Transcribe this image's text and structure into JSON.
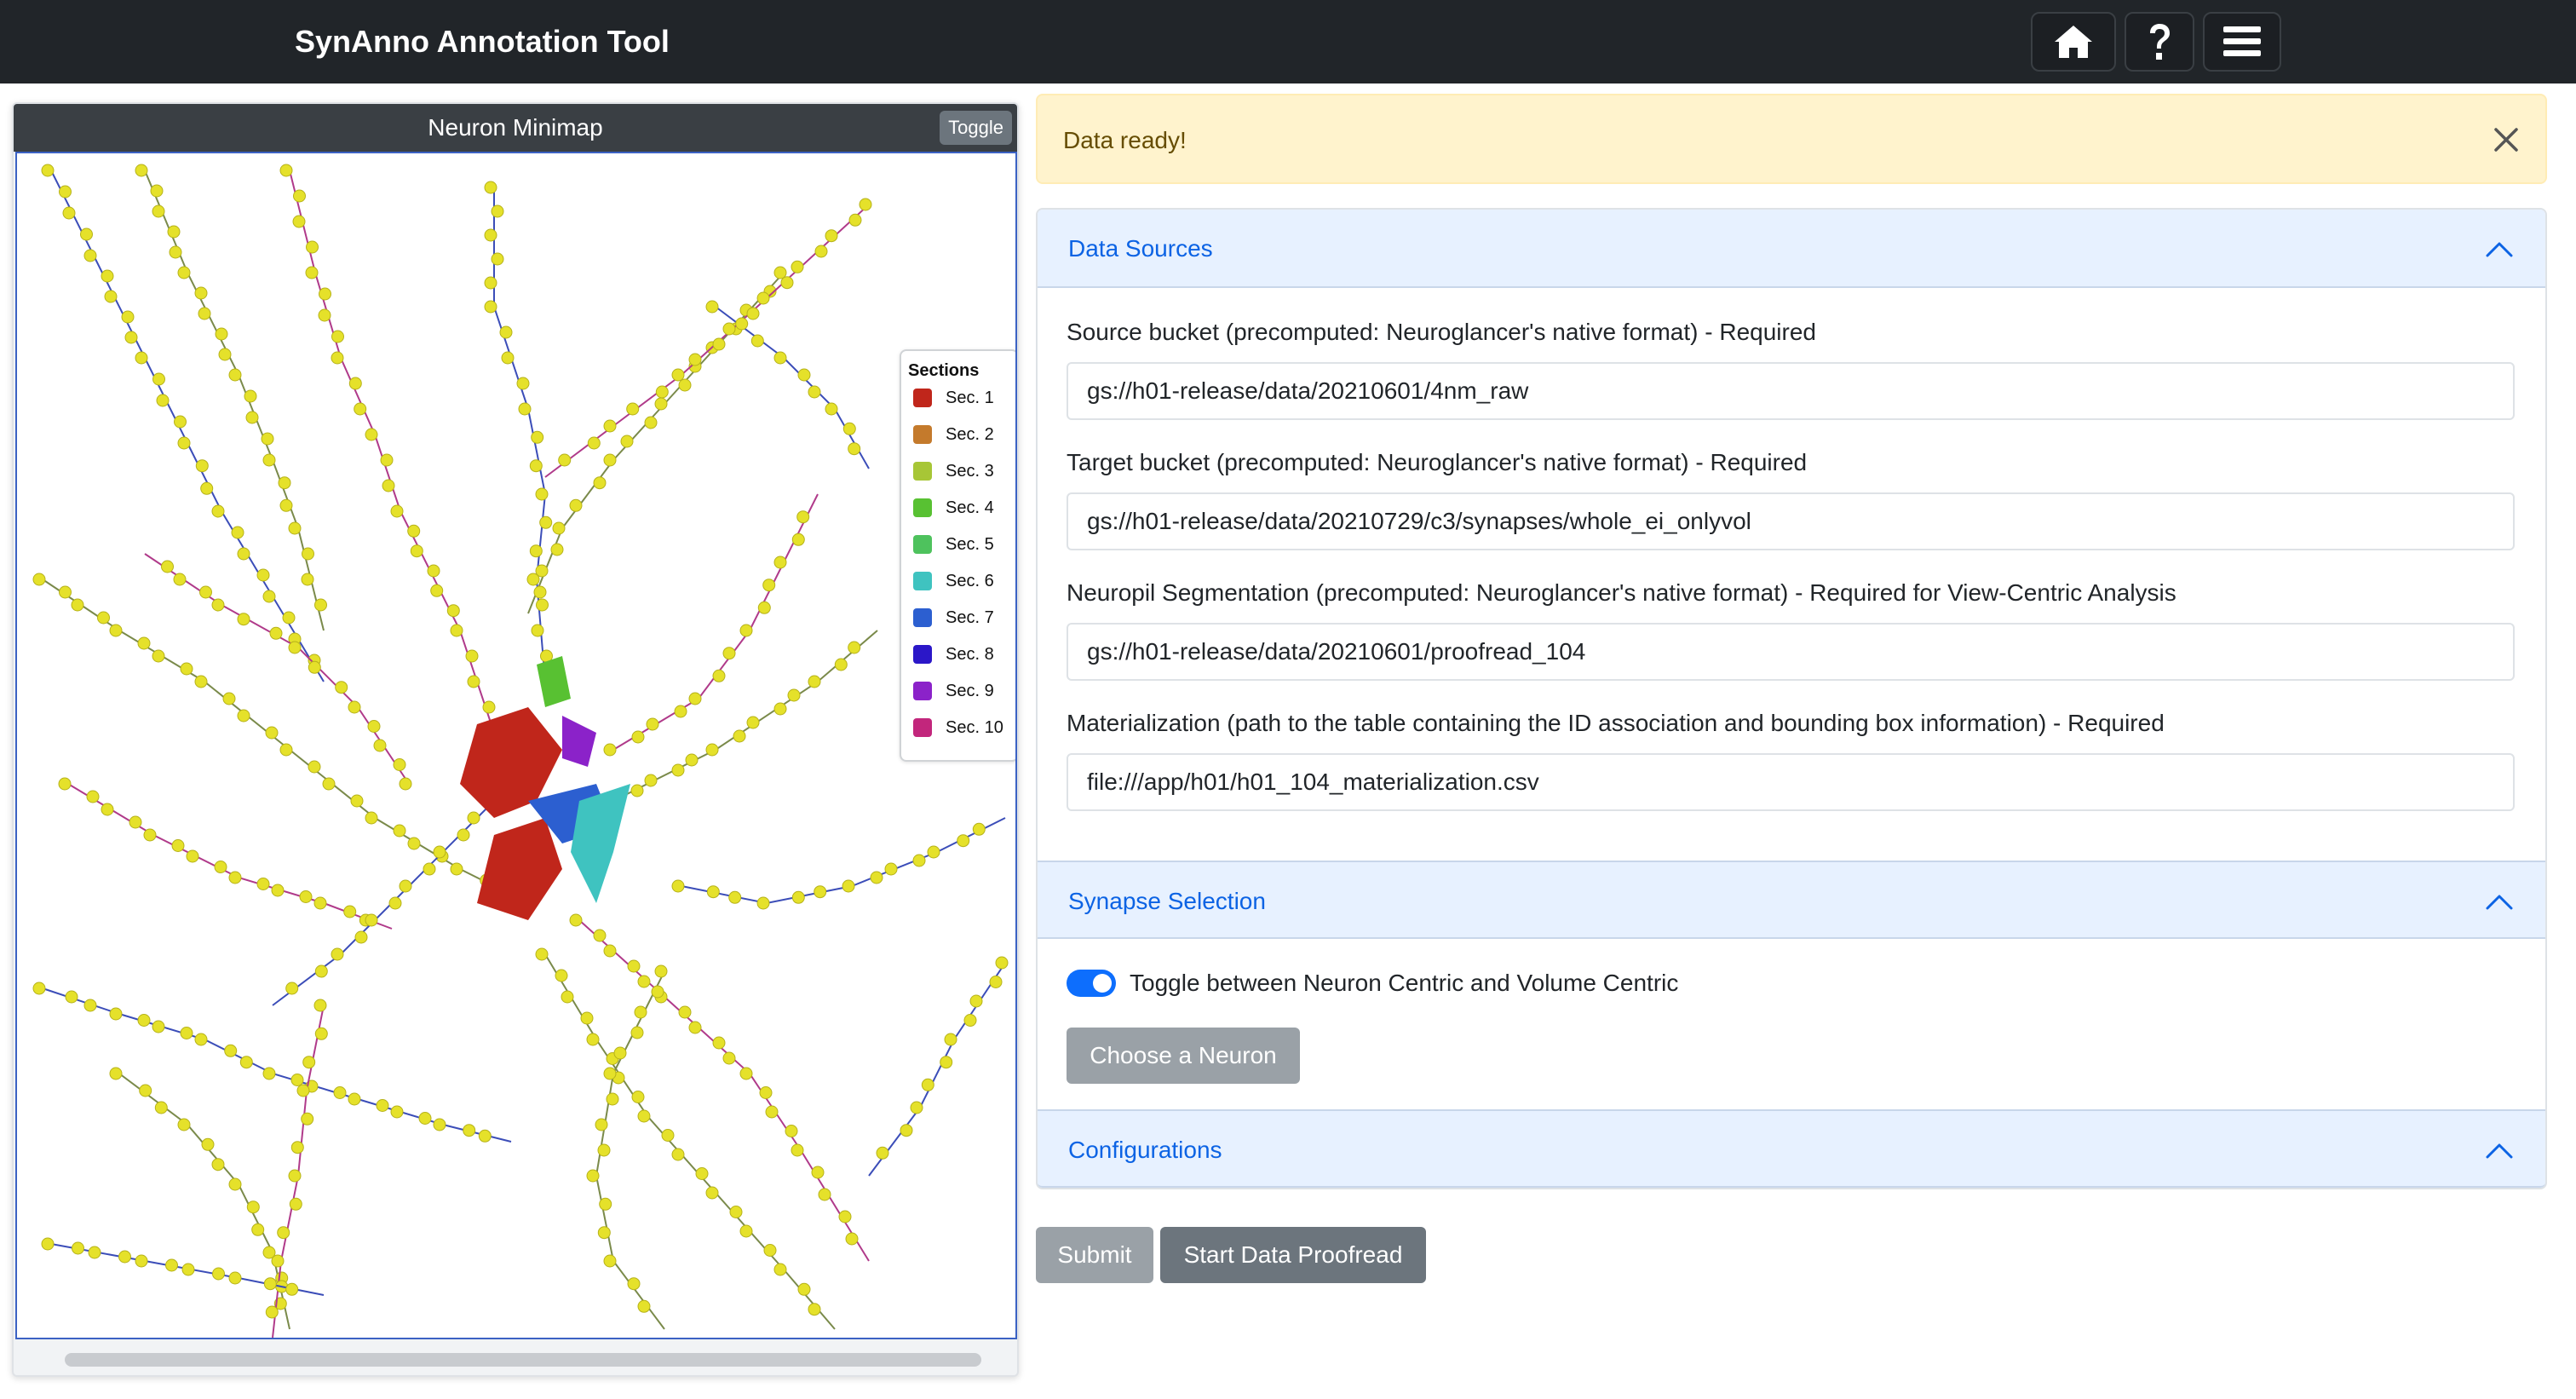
{
  "navbar": {
    "brand": "SynAnno Annotation Tool",
    "buttons": [
      {
        "name": "home-button",
        "icon": "home-icon"
      },
      {
        "name": "help-button",
        "icon": "question-icon"
      },
      {
        "name": "menu-button",
        "icon": "menu-icon"
      }
    ]
  },
  "minimap": {
    "title": "Neuron Minimap",
    "toggle_label": "Toggle",
    "legend": {
      "title": "Sections",
      "items": [
        {
          "label": "Sec. 1",
          "color": "#c0261b"
        },
        {
          "label": "Sec. 2",
          "color": "#c47a2c"
        },
        {
          "label": "Sec. 3",
          "color": "#a7c636"
        },
        {
          "label": "Sec. 4",
          "color": "#58c132"
        },
        {
          "label": "Sec. 5",
          "color": "#4ec25d"
        },
        {
          "label": "Sec. 6",
          "color": "#3fc3c0"
        },
        {
          "label": "Sec. 7",
          "color": "#2c5fd0"
        },
        {
          "label": "Sec. 8",
          "color": "#2b17c8"
        },
        {
          "label": "Sec. 9",
          "color": "#8b22c9"
        },
        {
          "label": "Sec. 10",
          "color": "#c2267c"
        }
      ]
    }
  },
  "alert": {
    "text": "Data ready!"
  },
  "data_sources": {
    "title": "Data Sources",
    "fields": [
      {
        "label": "Source bucket (precomputed: Neuroglancer's native format) - Required",
        "value": "gs://h01-release/data/20210601/4nm_raw"
      },
      {
        "label": "Target bucket (precomputed: Neuroglancer's native format) - Required",
        "value": "gs://h01-release/data/20210729/c3/synapses/whole_ei_onlyvol"
      },
      {
        "label": "Neuropil Segmentation (precomputed: Neuroglancer's native format) - Required for View-Centric Analysis",
        "value": "gs://h01-release/data/20210601/proofread_104"
      },
      {
        "label": "Materialization (path to the table containing the ID association and bounding box information) - Required",
        "value": "file:///app/h01/h01_104_materialization.csv"
      }
    ]
  },
  "synapse_selection": {
    "title": "Synapse Selection",
    "toggle_label": "Toggle between Neuron Centric and Volume Centric",
    "toggle_on": true,
    "choose_label": "Choose a Neuron"
  },
  "configurations": {
    "title": "Configurations"
  },
  "actions": {
    "submit_label": "Submit",
    "proofread_label": "Start Data Proofread"
  },
  "colors": {
    "navbar": "#212529",
    "accent": "#0c63e4",
    "alert_bg": "#fff3cd",
    "node_yellow": "#e5e12a"
  }
}
